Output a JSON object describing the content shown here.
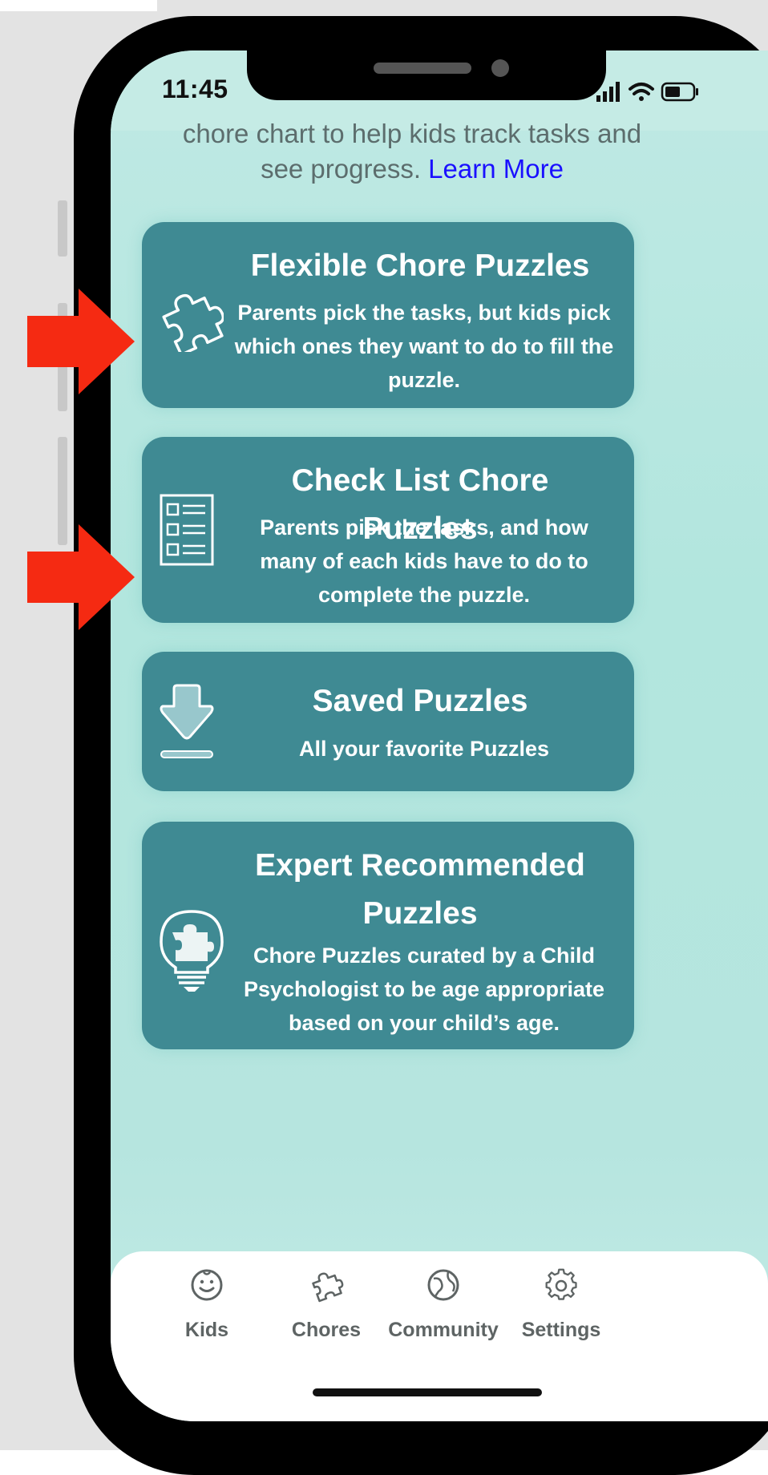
{
  "status_bar": {
    "time": "11:45"
  },
  "intro": {
    "line1": "chore chart to help kids track tasks and",
    "line2": "see progress.",
    "link_label": "Learn More"
  },
  "cards": [
    {
      "title": "Flexible Chore Puzzles",
      "description": "Parents pick the tasks, but kids pick which ones they want to do to fill the puzzle.",
      "icon": "puzzle-piece-icon"
    },
    {
      "title": "Check List Chore Puzzles",
      "description": "Parents pick the tasks, and how many of each kids have to do to complete the puzzle.",
      "icon": "checklist-icon"
    },
    {
      "title": "Saved Puzzles",
      "description": "All your favorite Puzzles",
      "icon": "download-arrow-icon"
    },
    {
      "title": "Expert Recommended Puzzles",
      "description": "Chore Puzzles curated by a Child Psychologist to be age appropriate based on your child’s age.",
      "icon": "lightbulb-puzzle-icon"
    }
  ],
  "tabs": [
    {
      "label": "Kids",
      "icon": "smiley-face-icon"
    },
    {
      "label": "Chores",
      "icon": "puzzle-icon"
    },
    {
      "label": "Community",
      "icon": "globe-icon"
    },
    {
      "label": "Settings",
      "icon": "gear-icon"
    }
  ],
  "annotations": {
    "arrow_color": "#f52a12"
  },
  "colors": {
    "card_background": "#3f8a93",
    "screen_background": "#b2e6de",
    "link": "#1a10ff"
  }
}
